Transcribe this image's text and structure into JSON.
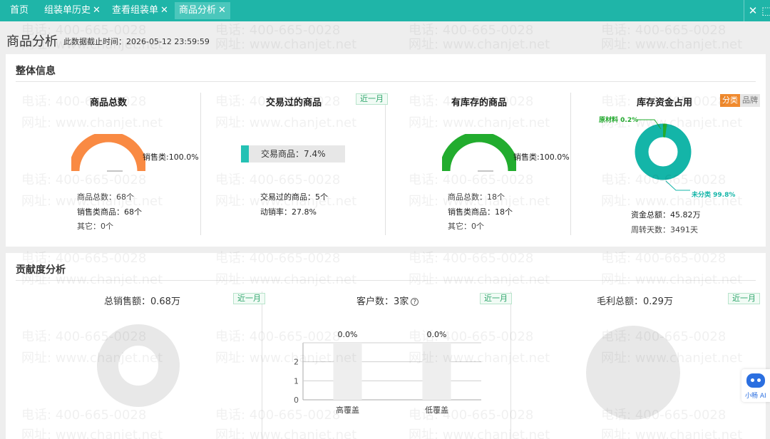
{
  "tabs": [
    {
      "label": "首页",
      "closable": false,
      "active": false
    },
    {
      "label": "组装单历史",
      "closable": true,
      "active": false
    },
    {
      "label": "查看组装单",
      "closable": true,
      "active": false
    },
    {
      "label": "商品分析",
      "closable": true,
      "active": true
    }
  ],
  "tab_close_glyph": "✕",
  "tabbar_right": {
    "close_glyph": "✕",
    "extra_glyph": "⬚"
  },
  "page": {
    "title": "商品分析",
    "cutoff_label": "此数据截止时间：",
    "cutoff_time": "2026-05-12 23:59:59"
  },
  "overview": {
    "title": "整体信息",
    "total_goods": {
      "title": "商品总数",
      "donut_label": "销售类:100.0%",
      "share": 100.0,
      "color": "#f98a43",
      "lines": [
        "商品总数：68个",
        "销售类商品：68个",
        "其它：0个"
      ]
    },
    "traded_goods": {
      "title": "交易过的商品",
      "badge": "近一月",
      "progress_label": "交易商品：7.4%",
      "progress": 7.4,
      "color": "#25c1b4",
      "lines": [
        "交易过的商品：5个",
        "动销率：27.8%"
      ]
    },
    "stocked_goods": {
      "title": "有库存的商品",
      "donut_label": "销售类:100.0%",
      "share": 100.0,
      "color": "#22ac2e",
      "lines": [
        "商品总数：18个",
        "销售类商品：18个",
        "其它：0个"
      ]
    },
    "inventory_funds": {
      "title": "库存资金占用",
      "toggle": [
        "分类",
        "品牌"
      ],
      "slices": [
        {
          "name": "原材料",
          "pct_label": "0.2%",
          "value": 0.2,
          "color": "#22ac2e"
        },
        {
          "name": "未分类",
          "pct_label": "99.8%",
          "value": 99.8,
          "color": "#14b5a8"
        }
      ],
      "lines": [
        "资金总额：45.82万",
        "周转天数：3491天"
      ]
    }
  },
  "contribution": {
    "title": "贡献度分析",
    "sales": {
      "title": "总销售额：0.68万",
      "badge": "近一月"
    },
    "customers": {
      "title": "客户数：3家",
      "help": "?",
      "badge": "近一月",
      "chart_data": {
        "type": "bar",
        "categories": [
          "高覆盖",
          "低覆盖"
        ],
        "values": [
          0.0,
          0.0
        ],
        "data_labels": [
          "0.0%",
          "0.0%"
        ],
        "yticks": [
          "0",
          "1",
          "2"
        ],
        "ylim": [
          0,
          3
        ],
        "title": "",
        "xlabel": "",
        "ylabel": ""
      }
    },
    "profit": {
      "title": "毛利总额：0.29万",
      "badge": "近一月"
    }
  },
  "watermark": {
    "phone": "电话: 400-665-0028",
    "site": "网址: www.chanjet.net"
  },
  "assistant": {
    "label": "小畅 AI"
  }
}
